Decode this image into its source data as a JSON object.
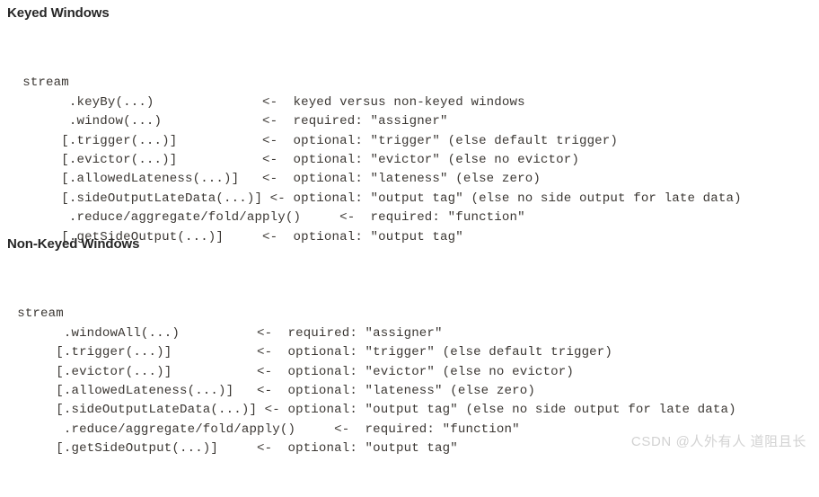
{
  "document": {
    "background_color": "#ffffff",
    "code_text_color": "#3b3733",
    "heading_color": "#262626",
    "watermark_color": "#d2d2d2"
  },
  "sections": [
    {
      "id": "keyed",
      "heading": "Keyed Windows",
      "code_lines": [
        "  stream",
        "        .keyBy(...)              <-  keyed versus non-keyed windows",
        "        .window(...)             <-  required: \"assigner\"",
        "       [.trigger(...)]           <-  optional: \"trigger\" (else default trigger)",
        "       [.evictor(...)]           <-  optional: \"evictor\" (else no evictor)",
        "       [.allowedLateness(...)]   <-  optional: \"lateness\" (else zero)",
        "       [.sideOutputLateData(...)] <- optional: \"output tag\" (else no side output for late data)",
        "        .reduce/aggregate/fold/apply()     <-  required: \"function\"",
        "       [.getSideOutput(...)]     <-  optional: \"output tag\""
      ]
    },
    {
      "id": "nonkeyed",
      "heading": "Non-Keyed Windows",
      "code_lines": [
        "  stream",
        "        .windowAll(...)          <-  required: \"assigner\"",
        "       [.trigger(...)]           <-  optional: \"trigger\" (else default trigger)",
        "       [.evictor(...)]           <-  optional: \"evictor\" (else no evictor)",
        "       [.allowedLateness(...)]   <-  optional: \"lateness\" (else zero)",
        "       [.sideOutputLateData(...)] <- optional: \"output tag\" (else no side output for late data)",
        "        .reduce/aggregate/fold/apply()     <-  required: \"function\"",
        "       [.getSideOutput(...)]     <-  optional: \"output tag\""
      ]
    }
  ],
  "watermark": {
    "text": "CSDN @人外有人 道阻且长"
  }
}
